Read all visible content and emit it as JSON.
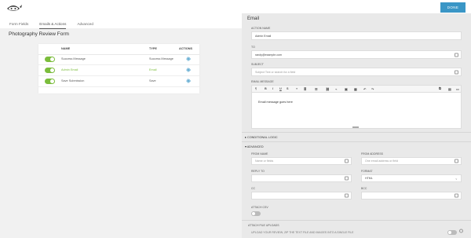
{
  "header": {
    "tabs": [
      "Form Fields",
      "Emails & Actions",
      "Advanced"
    ],
    "active_tab": 1,
    "done_label": "DONE",
    "brand_color": "#3a96c6"
  },
  "form": {
    "title": "Photography Review Form"
  },
  "actions_table": {
    "columns": [
      "NAME",
      "TYPE",
      "ACTIONS"
    ],
    "rows": [
      {
        "name": "Success Message",
        "type": "Success Message",
        "enabled": true,
        "highlight": false
      },
      {
        "name": "Admin Email",
        "type": "Email",
        "enabled": true,
        "highlight": true
      },
      {
        "name": "Save Submission",
        "type": "Save",
        "enabled": true,
        "highlight": false
      }
    ],
    "accent": "#7bbd3c",
    "action_icon": "gear-icon"
  },
  "panel": {
    "title": "Email",
    "action_name_label": "ACTION NAME",
    "action_name_value": "Admin Email",
    "to_label": "TO",
    "to_value": "randy@example.com",
    "subject_label": "SUBJECT",
    "subject_placeholder": "Subject Text or search for a field",
    "message_label": "EMAIL MESSAGE",
    "message_body": "Email message goes here",
    "toolbar": {
      "paragraph": "¶",
      "bold": "B",
      "italic": "I",
      "underline": "U"
    },
    "conditional_logic": "CONDITIONAL LOGIC",
    "advanced": "ADVANCED",
    "from_name_label": "FROM NAME",
    "from_name_placeholder": "Name or fields",
    "from_address_label": "FROM ADDRESS",
    "from_address_placeholder": "One email address or field",
    "reply_to_label": "REPLY TO",
    "format_label": "FORMAT",
    "format_value": "HTML",
    "cc_label": "CC",
    "bcc_label": "BCC",
    "attach_csv_label": "ATTACH CSV",
    "attach_uploads_label": "ATTACH FILE UPLOADS",
    "attach_uploads_note": "UPLOAD YOUR REVIEW, ZIP THE TEXT FILE AND IMAGES INTO A SINGLE FILE"
  }
}
